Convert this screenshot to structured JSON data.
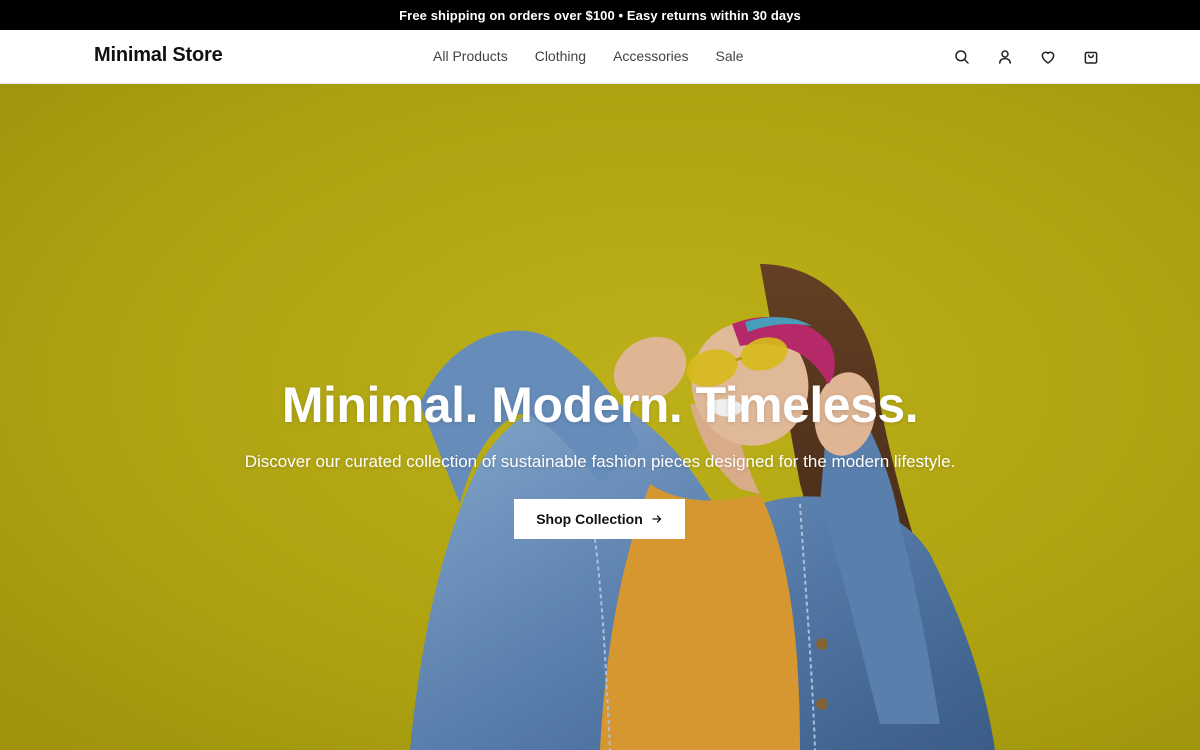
{
  "announcement": "Free shipping on orders over $100 • Easy returns within 30 days",
  "header": {
    "logo": "Minimal Store",
    "nav": [
      "All Products",
      "Clothing",
      "Accessories",
      "Sale"
    ],
    "icons": [
      "search-icon",
      "account-icon",
      "wishlist-heart-icon",
      "cart-bag-icon"
    ]
  },
  "hero": {
    "title": "Minimal. Modern. Timeless.",
    "subtitle": "Discover our curated collection of sustainable fashion pieces designed for the modern lifestyle.",
    "cta_label": "Shop Collection",
    "cta_icon": "arrow-right-icon",
    "image": "woman-in-denim-jacket-and-sunglasses-on-yellow-wall"
  },
  "colors": {
    "announcement_bg": "#000000",
    "hero_bg": "#b8ae12",
    "text_dark": "#111111"
  }
}
